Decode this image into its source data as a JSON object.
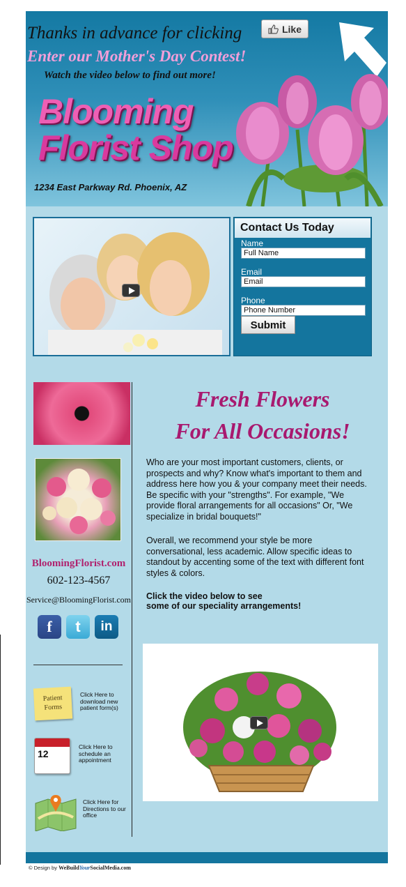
{
  "header": {
    "promo_line1": "Thanks in advance for clicking",
    "promo_line2": "Enter our Mother's Day Contest!",
    "promo_line3": "Watch the video below to find out more!",
    "like_label": "Like",
    "shop_name_line1": "Blooming",
    "shop_name_line2": "Florist Shop",
    "address": "1234 East Parkway Rd. Phoenix, AZ"
  },
  "contact": {
    "title": "Contact Us Today",
    "fields": [
      {
        "label": "Name",
        "value": "Full Name"
      },
      {
        "label": "Email",
        "value": "Email"
      },
      {
        "label": "Phone",
        "value": "Phone Number"
      }
    ],
    "submit_label": "Submit"
  },
  "sidebar": {
    "website": "BloomingFlorist.com",
    "phone": "602-123-4567",
    "email": "Service@BloomingFlorist.com",
    "social": [
      "facebook-icon",
      "twitter-icon",
      "linkedin-icon"
    ],
    "tools": [
      {
        "icon_line1": "Patient",
        "icon_line2": "Forms",
        "text": "Click Here to download new patient form(s)"
      },
      {
        "icon_number": "12",
        "text": "Click Here to schedule an appointment"
      },
      {
        "text": "Click Here for Directions to our office"
      }
    ]
  },
  "main": {
    "headline_line1": "Fresh Flowers",
    "headline_line2": "For All Occasions!",
    "para1": "Who are your most important customers, clients, or prospects and why? Know what's important to them and address here how you & your company meet their needs. Be specific with your \"strengths\". For example, \"We provide floral arrangements for all occasions\" Or, \"We specialize in bridal bouquets!\"",
    "para2": "Overall, we recommend your style be more conversational, less academic. Allow specific ideas to standout by accenting some of the text with different font styles & colors.",
    "cta_line1": "Click the video below to see",
    "cta_line2": "some of our speciality arrangements!"
  },
  "footer": {
    "credit_prefix": "© Design by",
    "credit_we": "We",
    "credit_build": "Build",
    "credit_your": "Your",
    "credit_social": "Social",
    "credit_media": "Media",
    "credit_com": ".com"
  },
  "colors": {
    "page_bg": "#b3dae8",
    "header_blue": "#14759e",
    "headline_magenta": "#a8196f",
    "promo_pink": "#f29fd9"
  }
}
